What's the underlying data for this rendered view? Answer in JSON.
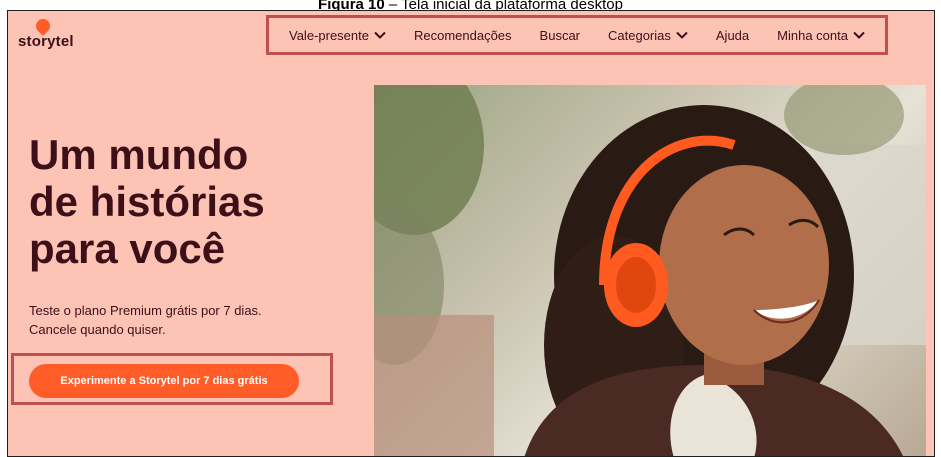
{
  "caption": {
    "label": "Figura 10",
    "text": " – Tela inicial da plataforma desktop"
  },
  "brand": {
    "name": "storytel",
    "accent": "#ff5c28",
    "text_color": "#3d0f19",
    "background": "#fdc4b6"
  },
  "nav": {
    "items": [
      {
        "label": "Vale-presente",
        "icon": "chevron-down-icon"
      },
      {
        "label": "Recomendações"
      },
      {
        "label": "Buscar"
      },
      {
        "label": "Categorias",
        "icon": "chevron-down-icon"
      },
      {
        "label": "Ajuda"
      },
      {
        "label": "Minha conta",
        "icon": "chevron-down-icon"
      }
    ]
  },
  "hero": {
    "headline_lines": [
      "Um mundo",
      "de histórias",
      "para você"
    ],
    "subtext": "Teste o plano Premium grátis por 7 dias. Cancele quando quiser.",
    "cta_label": "Experimente a Storytel por 7 dias grátis"
  },
  "highlight_color": "#c0504d"
}
